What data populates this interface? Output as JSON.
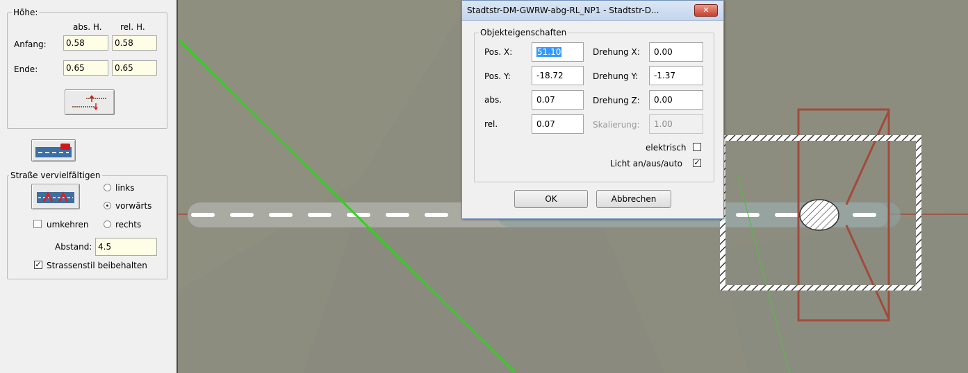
{
  "left_panel": {
    "hoehe_group": {
      "title": "Höhe:",
      "col_abs": "abs. H.",
      "col_rel": "rel. H.",
      "anfang_label": "Anfang:",
      "anfang_abs": "0.58",
      "anfang_rel": "0.58",
      "ende_label": "Ende:",
      "ende_abs": "0.65",
      "ende_rel": "0.65"
    },
    "strasse_group": {
      "title": "Straße vervielfältigen",
      "radio_links": "links",
      "radio_vorwaerts": "vorwärts",
      "radio_rechts": "rechts",
      "selected": "vorwärts",
      "umkehren_label": "umkehren",
      "umkehren_checked": false,
      "abstand_label": "Abstand:",
      "abstand_value": "4.5",
      "stil_label": "Strassenstil beibehalten",
      "stil_checked": true
    }
  },
  "dialog": {
    "title": "Stadtstr-DM-GWRW-abg-RL_NP1 - Stadtstr-D...",
    "close_symbol": "✕",
    "group_title": "Objekteigenschaften",
    "pos_x_label": "Pos. X:",
    "pos_x_value": "51.10",
    "pos_y_label": "Pos. Y:",
    "pos_y_value": "-18.72",
    "abs_label": "abs.",
    "abs_value": "0.07",
    "rel_label": "rel.",
    "rel_value": "0.07",
    "drehung_x_label": "Drehung X:",
    "drehung_x_value": "0.00",
    "drehung_y_label": "Drehung Y:",
    "drehung_y_value": "-1.37",
    "drehung_z_label": "Drehung Z:",
    "drehung_z_value": "0.00",
    "skalierung_label": "Skalierung:",
    "skalierung_value": "1.00",
    "elektrisch_label": "elektrisch",
    "elektrisch_checked": false,
    "licht_label": "Licht an/aus/auto",
    "licht_checked": true,
    "ok_label": "OK",
    "cancel_label": "Abbrechen"
  },
  "colors": {
    "viewport_bg": "#8c8d7f",
    "green_line": "#2fd21c",
    "red_outline": "#a24a3a",
    "road": "#a9aaa2",
    "selection_hatch": "#ffffff"
  }
}
